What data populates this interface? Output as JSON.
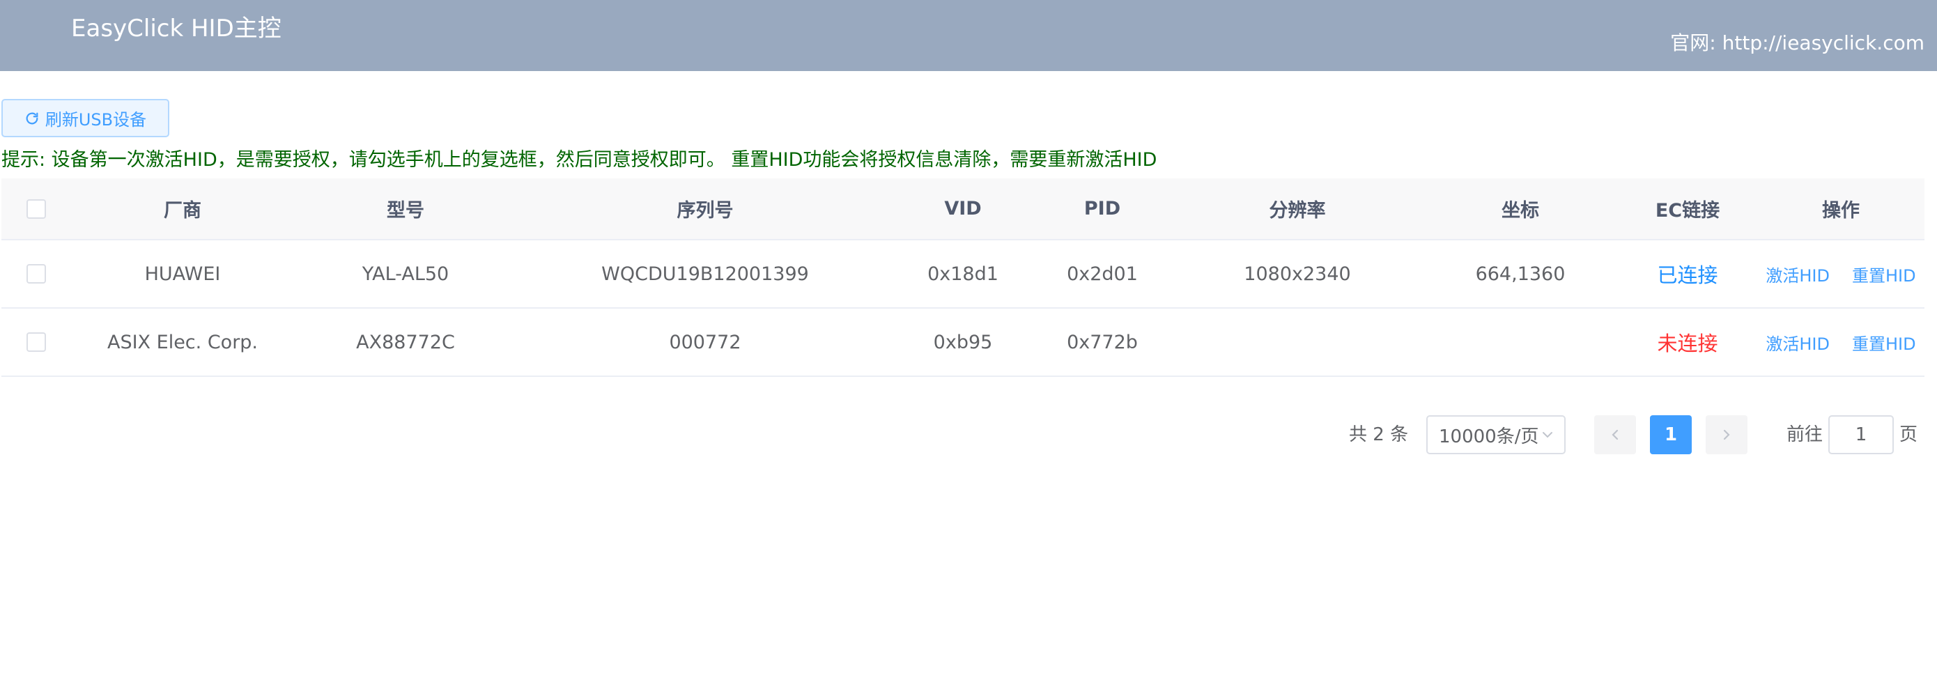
{
  "header": {
    "title": "EasyClick HID主控",
    "site": "官网: http://ieasyclick.com"
  },
  "toolbar": {
    "refresh_label": "刷新USB设备"
  },
  "tip": "提示: 设备第一次激活HID，是需要授权，请勾选手机上的复选框，然后同意授权即可。 重置HID功能会将授权信息清除，需要重新激活HID",
  "table": {
    "columns": [
      "厂商",
      "型号",
      "序列号",
      "VID",
      "PID",
      "分辨率",
      "坐标",
      "EC链接",
      "操作"
    ],
    "rows": [
      {
        "vendor": "HUAWEI",
        "model": "YAL-AL50",
        "serial": "WQCDU19B12001399",
        "vid": "0x18d1",
        "pid": "0x2d01",
        "resolution": "1080x2340",
        "coord": "664,1360",
        "ec_status": "已连接",
        "ec_connected": true,
        "op_activate": "激活HID",
        "op_reset": "重置HID"
      },
      {
        "vendor": "ASIX Elec. Corp.",
        "model": "AX88772C",
        "serial": "000772",
        "vid": "0xb95",
        "pid": "0x772b",
        "resolution": "",
        "coord": "",
        "ec_status": "未连接",
        "ec_connected": false,
        "op_activate": "激活HID",
        "op_reset": "重置HID"
      }
    ]
  },
  "pagination": {
    "total": "共 2 条",
    "page_size": "10000条/页",
    "current_page": "1",
    "goto_label": "前往",
    "goto_value": "1",
    "page_unit": "页"
  },
  "colors": {
    "header_bg": "#99a9bf",
    "tip_text": "#006400",
    "connected": "#1e90ff",
    "disconnected": "#ff3333",
    "accent": "#409eff"
  }
}
